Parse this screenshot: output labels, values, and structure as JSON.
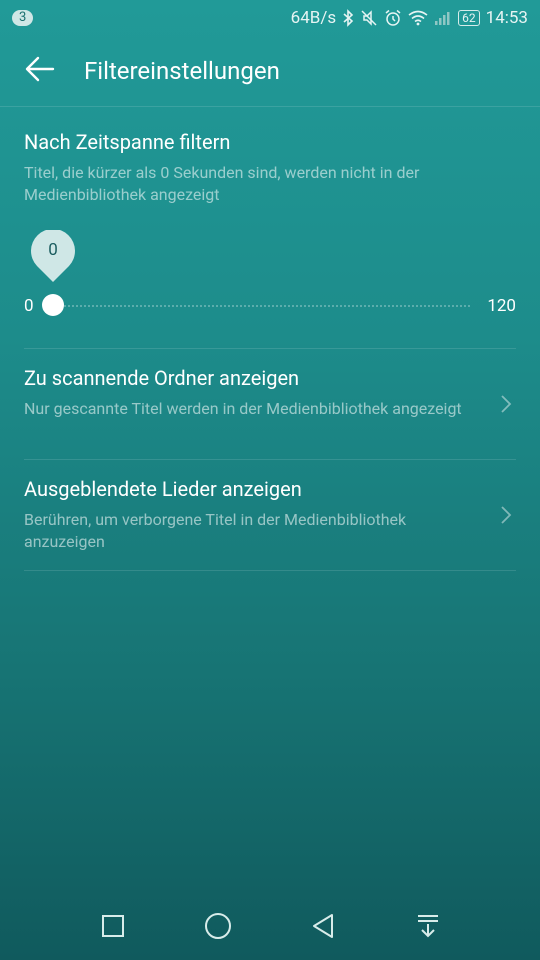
{
  "status": {
    "notif_count": "3",
    "net_speed": "64B/s",
    "battery": "62",
    "time": "14:53"
  },
  "appbar": {
    "title": "Filtereinstellungen"
  },
  "filter": {
    "heading": "Nach Zeitspanne filtern",
    "description": "Titel, die kürzer als 0 Sekunden sind, werden nicht in der Medienbibliothek angezeigt",
    "slider_value": "0",
    "slider_min": "0",
    "slider_max": "120"
  },
  "rows": [
    {
      "title": "Zu scannende Ordner anzeigen",
      "subtitle": "Nur gescannte Titel werden in der Medienbibliothek angezeigt"
    },
    {
      "title": "Ausgeblendete Lieder anzeigen",
      "subtitle": "Berühren, um verborgene Titel in der Medienbibliothek anzuzeigen"
    }
  ],
  "colors": {
    "background_top": "#219a98",
    "background_bottom": "#105a5d",
    "bubble": "#cfe7e6"
  },
  "icons": [
    "back-arrow-icon",
    "bluetooth-icon",
    "mute-icon",
    "alarm-icon",
    "wifi-icon",
    "signal-icon",
    "battery-icon",
    "chevron-right-icon",
    "square-nav-icon",
    "circle-nav-icon",
    "triangle-back-nav-icon",
    "notification-pull-icon"
  ]
}
